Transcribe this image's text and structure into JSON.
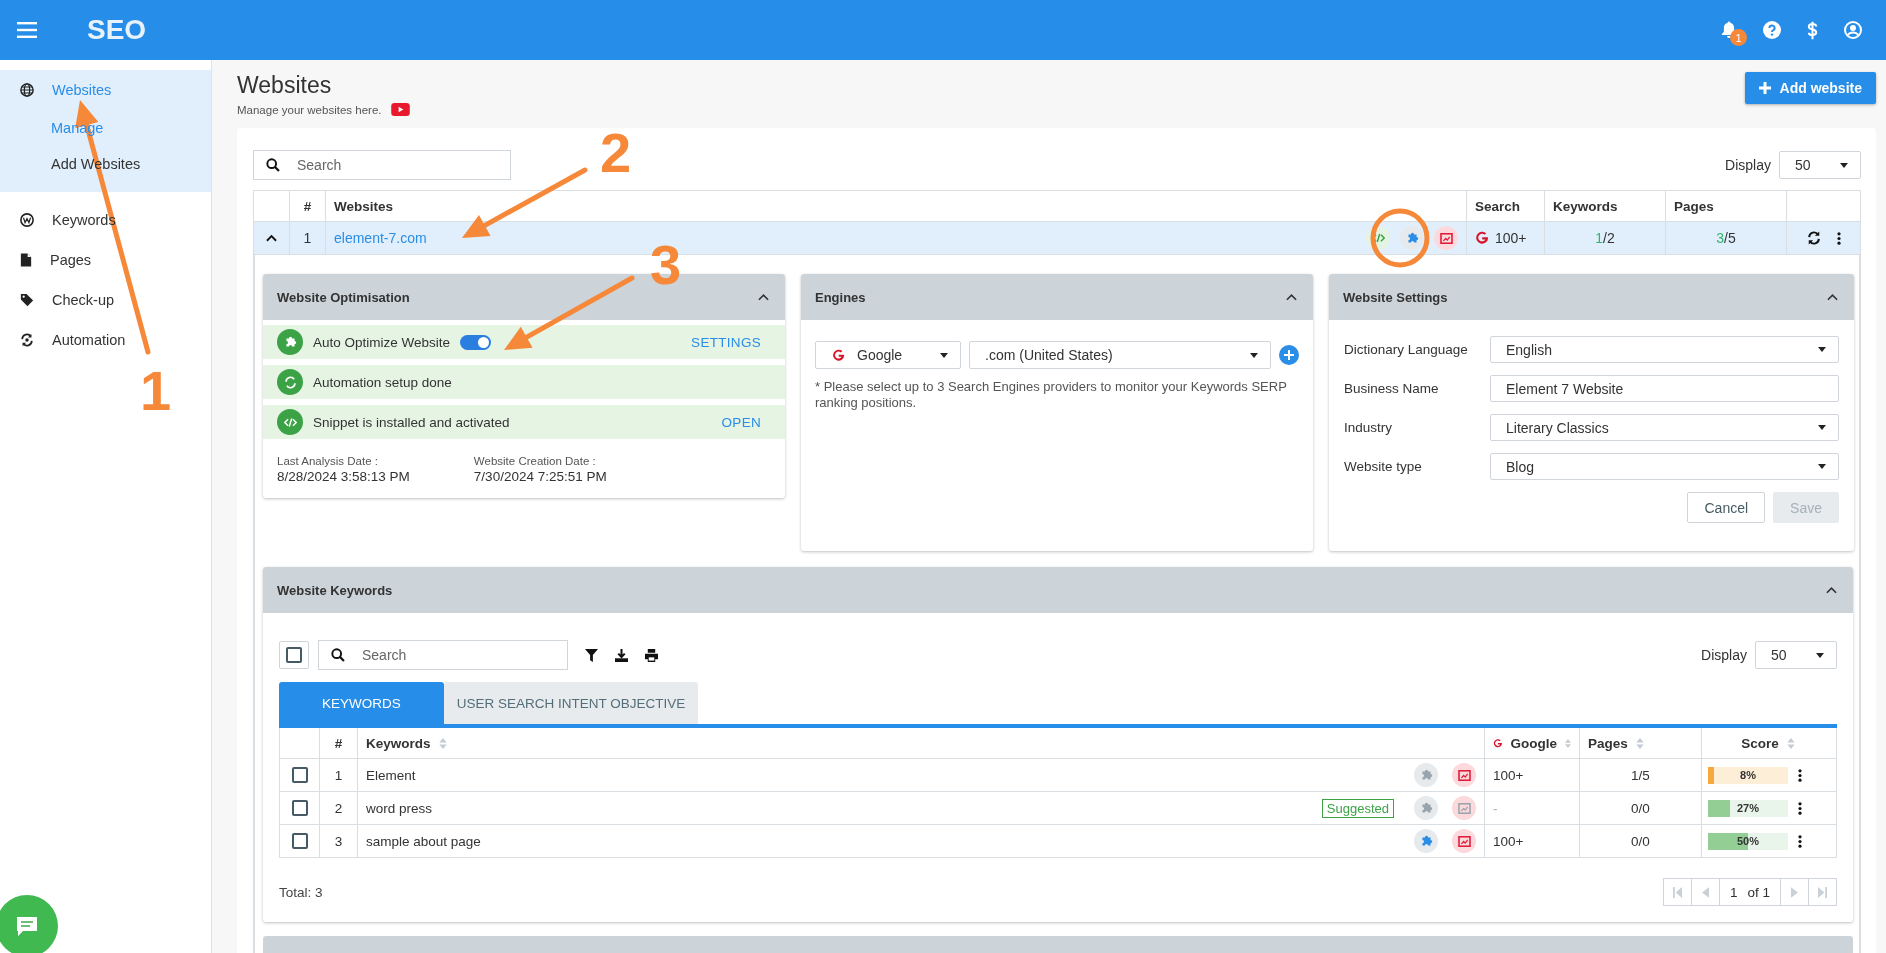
{
  "header": {
    "title": "SEO",
    "notification_count": "1"
  },
  "sidebar": {
    "items": [
      {
        "label": "Websites",
        "selected": true,
        "expanded": true,
        "children": [
          {
            "label": "Manage",
            "selected": true
          },
          {
            "label": "Add Websites",
            "selected": false
          }
        ]
      },
      {
        "label": "Keywords",
        "selected": false,
        "expanded": false
      },
      {
        "label": "Pages",
        "selected": false,
        "expanded": false
      },
      {
        "label": "Check-up",
        "selected": false,
        "expanded": false
      },
      {
        "label": "Automation",
        "selected": false,
        "expanded": false
      }
    ]
  },
  "page": {
    "title": "Websites",
    "subtitle": "Manage your websites here.",
    "add_button": "Add website"
  },
  "websites_table": {
    "search_placeholder": "Search",
    "display_label": "Display",
    "display_value": "50",
    "columns": [
      "#",
      "Websites",
      "Search",
      "Keywords",
      "Pages"
    ],
    "rows": [
      {
        "index": "1",
        "expanded": true,
        "site": "element-7.com",
        "search": "100+",
        "keywords_done": "1",
        "keywords_total": "/2",
        "pages_done": "3",
        "pages_total": "/5"
      }
    ]
  },
  "optimisation": {
    "title": "Website Optimisation",
    "items": [
      {
        "kind": "toggle",
        "label": "Auto Optimize Website",
        "on": true,
        "action": "SETTINGS"
      },
      {
        "kind": "plain",
        "label": "Automation setup done"
      },
      {
        "kind": "link",
        "label": "Snippet is installed and activated",
        "action": "OPEN"
      }
    ],
    "dates": [
      {
        "label": "Last Analysis Date :",
        "value": "8/28/2024 3:58:13 PM"
      },
      {
        "label": "Website Creation Date :",
        "value": "7/30/2024 7:25:51 PM"
      }
    ]
  },
  "engines": {
    "title": "Engines",
    "engine": "Google",
    "domain": ".com (United States)",
    "note": "* Please select up to 3 Search Engines providers to monitor your Keywords SERP ranking positions."
  },
  "settings": {
    "title": "Website Settings",
    "fields": [
      {
        "kind": "select",
        "label": "Dictionary Language",
        "value": "English"
      },
      {
        "kind": "text",
        "label": "Business Name",
        "value": "Element 7 Website"
      },
      {
        "kind": "select",
        "label": "Industry",
        "value": "Literary Classics"
      },
      {
        "kind": "select",
        "label": "Website type",
        "value": "Blog"
      }
    ],
    "buttons": [
      {
        "label": "Cancel",
        "disabled": false
      },
      {
        "label": "Save",
        "disabled": true
      }
    ]
  },
  "keywords": {
    "title": "Website Keywords",
    "select_all_checked": false,
    "search_placeholder": "Search",
    "display_label": "Display",
    "display_value": "50",
    "tabs": [
      {
        "label": "KEYWORDS",
        "selected": true
      },
      {
        "label": "USER SEARCH INTENT OBJECTIVE",
        "selected": false
      }
    ],
    "columns": [
      "#",
      "Keywords",
      "Google",
      "Pages",
      "Score"
    ],
    "rows": [
      {
        "index": "1",
        "checked": false,
        "keyword": "Element",
        "optimized": false,
        "report_enabled": true,
        "google": "100+",
        "pages": "1/5",
        "score": "8%",
        "level": 0.08,
        "color": "#f5a93a"
      },
      {
        "index": "2",
        "checked": false,
        "keyword": "word press",
        "badge": "Suggested",
        "optimized": false,
        "report_enabled": false,
        "google": "-",
        "pages": "0/0",
        "score": "27%",
        "level": 0.27,
        "color": "#93cf95"
      },
      {
        "index": "3",
        "checked": false,
        "keyword": "sample about page",
        "optimized": true,
        "report_enabled": true,
        "google": "100+",
        "pages": "0/0",
        "score": "50%",
        "level": 0.5,
        "color": "#93cf95"
      }
    ],
    "total": "Total: 3",
    "pagination": {
      "page": "1",
      "of": "of 1"
    }
  },
  "annotations": [
    {
      "label": "1"
    },
    {
      "label": "2"
    },
    {
      "label": "3"
    }
  ]
}
